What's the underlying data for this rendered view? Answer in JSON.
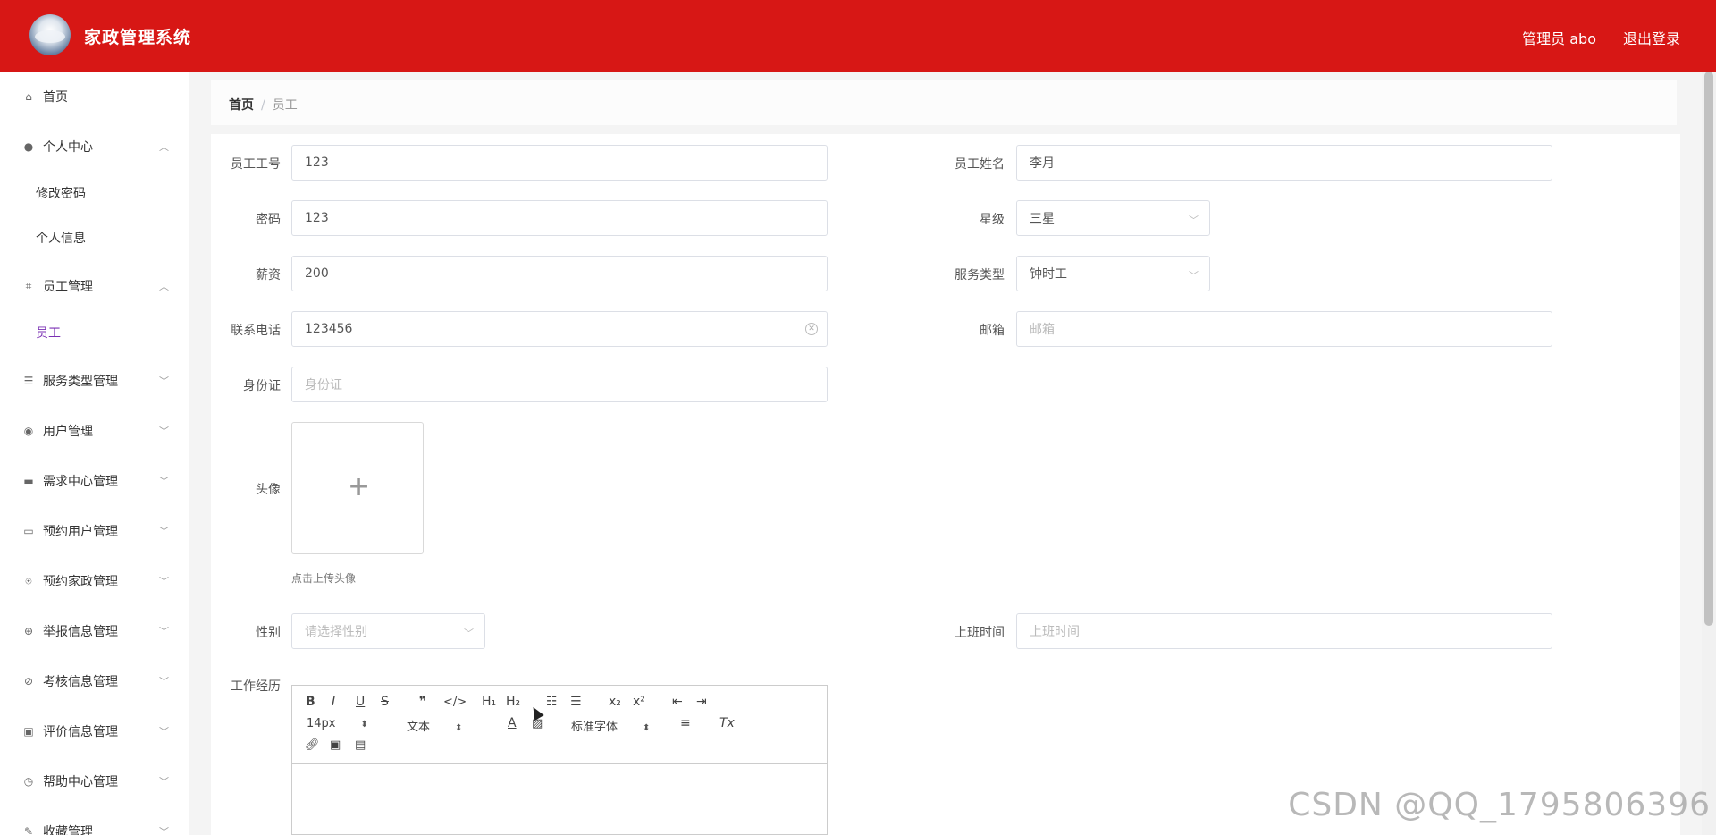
{
  "header": {
    "title": "家政管理系统",
    "user": "管理员 abo",
    "logout": "退出登录"
  },
  "sidebar": {
    "items": [
      {
        "label": "首页",
        "icon": "home-icon",
        "glyph": "⌂"
      },
      {
        "label": "个人中心",
        "icon": "user-icon",
        "glyph": "●",
        "arrow": "︿"
      },
      {
        "label": "修改密码",
        "sub": true
      },
      {
        "label": "个人信息",
        "sub": true
      },
      {
        "label": "员工管理",
        "icon": "scan-icon",
        "glyph": "⌗",
        "arrow": "︿"
      },
      {
        "label": "员工",
        "sub": true,
        "active": true
      },
      {
        "label": "服务类型管理",
        "icon": "list-icon",
        "glyph": "☰",
        "arrow": "﹀"
      },
      {
        "label": "用户管理",
        "icon": "location-icon",
        "glyph": "◉",
        "arrow": "﹀"
      },
      {
        "label": "需求中心管理",
        "icon": "message-icon",
        "glyph": "▬",
        "arrow": "﹀"
      },
      {
        "label": "预约用户管理",
        "icon": "monitor-icon",
        "glyph": "▭",
        "arrow": "﹀"
      },
      {
        "label": "预约家政管理",
        "icon": "microphone-icon",
        "glyph": "⍟",
        "arrow": "﹀"
      },
      {
        "label": "举报信息管理",
        "icon": "target-icon",
        "glyph": "⊕",
        "arrow": "﹀"
      },
      {
        "label": "考核信息管理",
        "icon": "compass-icon",
        "glyph": "⊘",
        "arrow": "﹀"
      },
      {
        "label": "评价信息管理",
        "icon": "clipboard-icon",
        "glyph": "▣",
        "arrow": "﹀"
      },
      {
        "label": "帮助中心管理",
        "icon": "clock-icon",
        "glyph": "◷",
        "arrow": "﹀"
      },
      {
        "label": "收藏管理",
        "icon": "edit-icon",
        "glyph": "✎",
        "arrow": "﹀"
      }
    ]
  },
  "breadcrumb": {
    "home": "首页",
    "sep": "/",
    "current": "员工"
  },
  "form": {
    "emp_no": {
      "label": "员工工号",
      "value": "123"
    },
    "emp_name": {
      "label": "员工姓名",
      "value": "李月"
    },
    "password": {
      "label": "密码",
      "value": "123"
    },
    "star": {
      "label": "星级",
      "value": "三星"
    },
    "salary": {
      "label": "薪资",
      "value": "200"
    },
    "service_type": {
      "label": "服务类型",
      "value": "钟时工"
    },
    "phone": {
      "label": "联系电话",
      "value": "123456"
    },
    "email": {
      "label": "邮箱",
      "placeholder": "邮箱"
    },
    "id_card": {
      "label": "身份证",
      "placeholder": "身份证"
    },
    "avatar": {
      "label": "头像",
      "hint": "点击上传头像"
    },
    "gender": {
      "label": "性别",
      "placeholder": "请选择性别"
    },
    "work_time": {
      "label": "上班时间",
      "placeholder": "上班时间"
    },
    "experience": {
      "label": "工作经历"
    }
  },
  "editor": {
    "font_size": "14px",
    "text_type": "文本",
    "font_family": "标准字体"
  },
  "watermark": "CSDN @QQ_1795806396"
}
